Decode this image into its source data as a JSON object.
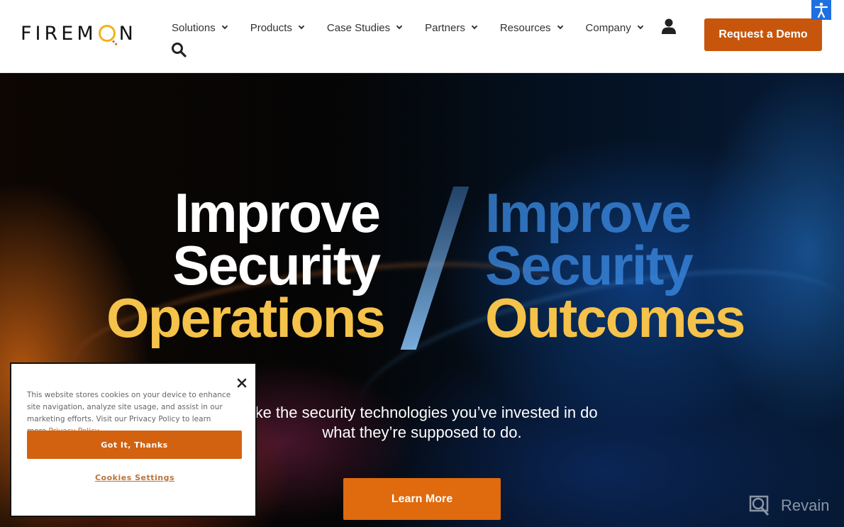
{
  "header": {
    "logo_text_before": "FIREM",
    "logo_text_after": "N",
    "nav": [
      {
        "label": "Solutions",
        "icon": "chevron-down-icon"
      },
      {
        "label": "Products",
        "icon": "chevron-down-icon"
      },
      {
        "label": "Case Studies",
        "icon": "chevron-down-icon"
      },
      {
        "label": "Partners",
        "icon": "chevron-down-icon"
      },
      {
        "label": "Resources",
        "icon": "chevron-down-icon"
      },
      {
        "label": "Company",
        "icon": "chevron-down-icon"
      }
    ],
    "user_icon": "user-icon",
    "search_icon": "search-icon",
    "demo_button": "Request a Demo",
    "accessibility_icon": "accessibility-icon"
  },
  "hero": {
    "left": {
      "line1": "Improve",
      "line2": "Security",
      "line3": "Operations"
    },
    "right": {
      "line1": "Improve",
      "line2": "Security",
      "line3": "Outcomes"
    },
    "subtext_line1": "ake the security technologies you’ve invested in do",
    "subtext_line2": "what they’re supposed to do.",
    "cta": "Learn More"
  },
  "cookie_banner": {
    "text": "This website stores cookies on your device to enhance site navigation, analyze site usage, and assist in our marketing efforts. Visit our Privacy Policy to learn more.",
    "link": "Privacy Policy",
    "accept": "Got It, Thanks",
    "settings": "Cookies Settings",
    "close_icon": "close-icon"
  },
  "watermark": {
    "label": "Revain"
  },
  "colors": {
    "brand_orange": "#c7560c",
    "cta_orange": "#e06a0e",
    "headline_yellow": "#f5c24a",
    "logo_yellow": "#f2b21d",
    "a11y_blue": "#1e6fe0"
  }
}
